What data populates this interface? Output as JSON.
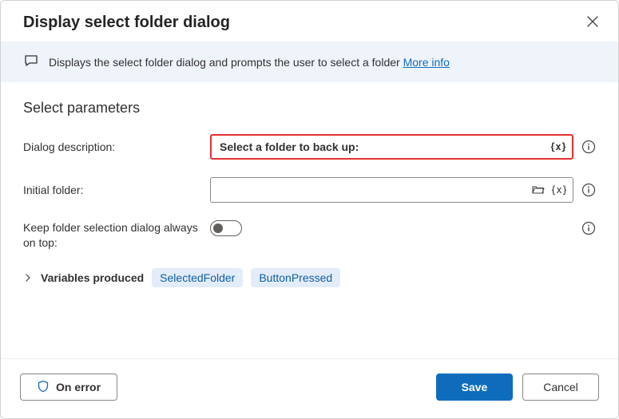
{
  "header": {
    "title": "Display select folder dialog"
  },
  "banner": {
    "text": "Displays the select folder dialog and prompts the user to select a folder",
    "more_info": "More info"
  },
  "section": {
    "title": "Select parameters"
  },
  "form": {
    "dialog_description": {
      "label": "Dialog description:",
      "value": "Select a folder to back up:"
    },
    "initial_folder": {
      "label": "Initial folder:",
      "value": ""
    },
    "always_on_top": {
      "label": "Keep folder selection dialog always on top:",
      "value": false
    }
  },
  "variables": {
    "label": "Variables produced",
    "items": [
      "SelectedFolder",
      "ButtonPressed"
    ]
  },
  "footer": {
    "on_error": "On error",
    "save": "Save",
    "cancel": "Cancel"
  }
}
